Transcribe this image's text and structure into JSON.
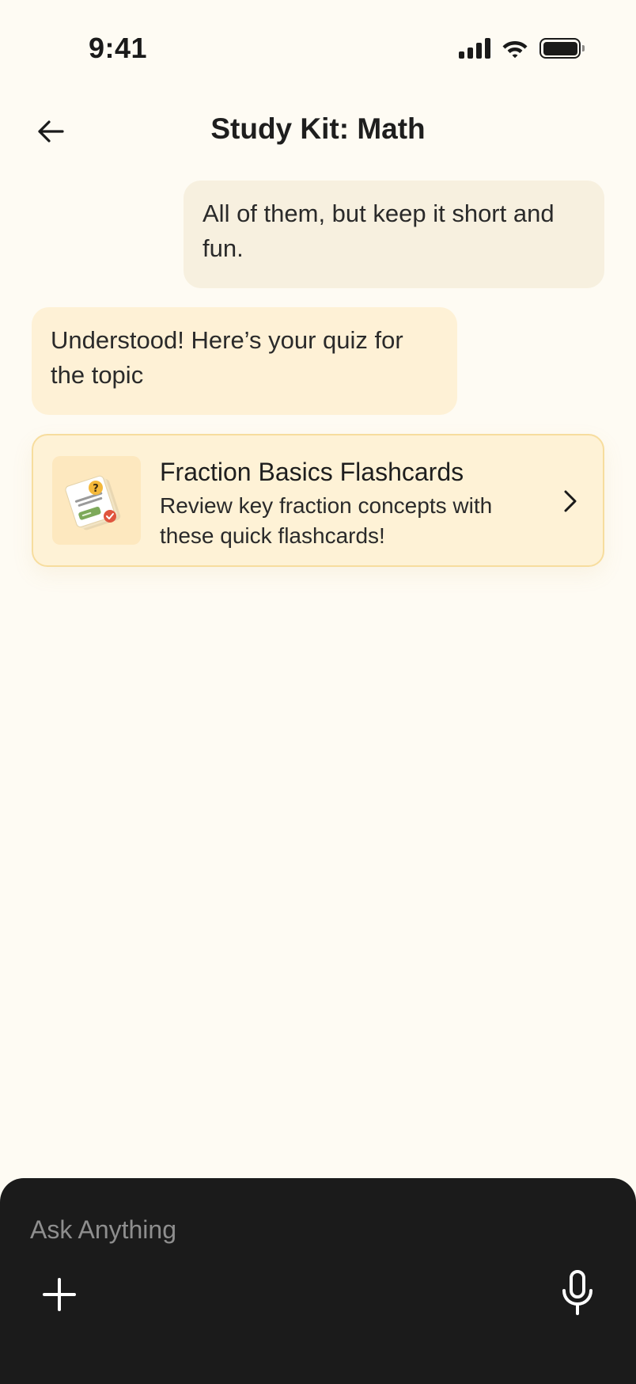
{
  "status_bar": {
    "time": "9:41",
    "signal_icon": "cellular-signal-icon",
    "wifi_icon": "wifi-icon",
    "battery_icon": "battery-full-icon"
  },
  "header": {
    "title": "Study Kit: Math",
    "back_icon": "arrow-left-icon"
  },
  "messages": [
    {
      "role": "user",
      "text": "All of them, but keep it short and fun."
    },
    {
      "role": "assistant",
      "text": "Understood! Here’s your quiz for the topic"
    }
  ],
  "flashcard": {
    "title": "Fraction Basics Flashcards",
    "description": "Review key fraction concepts with these quick flashcards!",
    "thumbnail_icon": "flashcards-illustration-icon",
    "chevron_icon": "chevron-right-icon"
  },
  "composer": {
    "placeholder": "Ask Anything",
    "value": "",
    "add_icon": "plus-icon",
    "mic_icon": "microphone-icon"
  },
  "colors": {
    "background": "#FEFBF3",
    "user_bubble": "#F7F0DF",
    "assistant_bubble": "#FEF1D6",
    "card_border": "#F7DD9E",
    "composer_bg": "#1B1B1B"
  }
}
